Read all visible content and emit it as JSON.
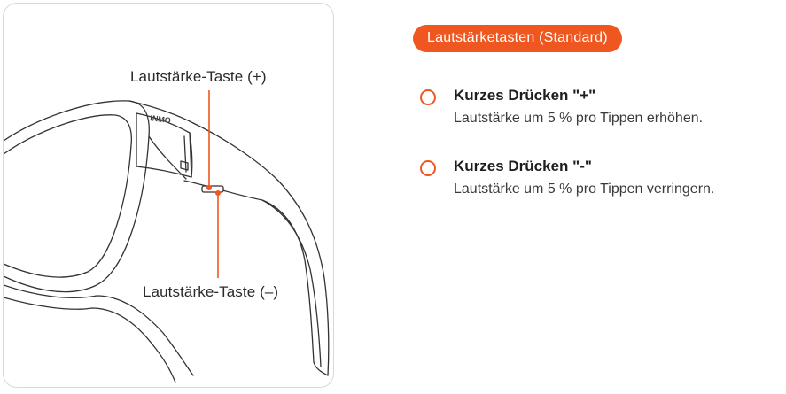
{
  "figure": {
    "label_plus": "Lautstärke-Taste (+)",
    "label_minus": "Lautstärke-Taste (–)",
    "logo_text": "INMO",
    "accent_color": "#f0561f"
  },
  "panel": {
    "badge": "Lautstärketasten (Standard)",
    "items": [
      {
        "title": "Kurzes Drücken \"+\"",
        "description": "Lautstärke um 5 % pro Tippen erhöhen."
      },
      {
        "title": "Kurzes Drücken \"-\"",
        "description": "Lautstärke um 5 % pro Tippen verringern."
      }
    ]
  }
}
